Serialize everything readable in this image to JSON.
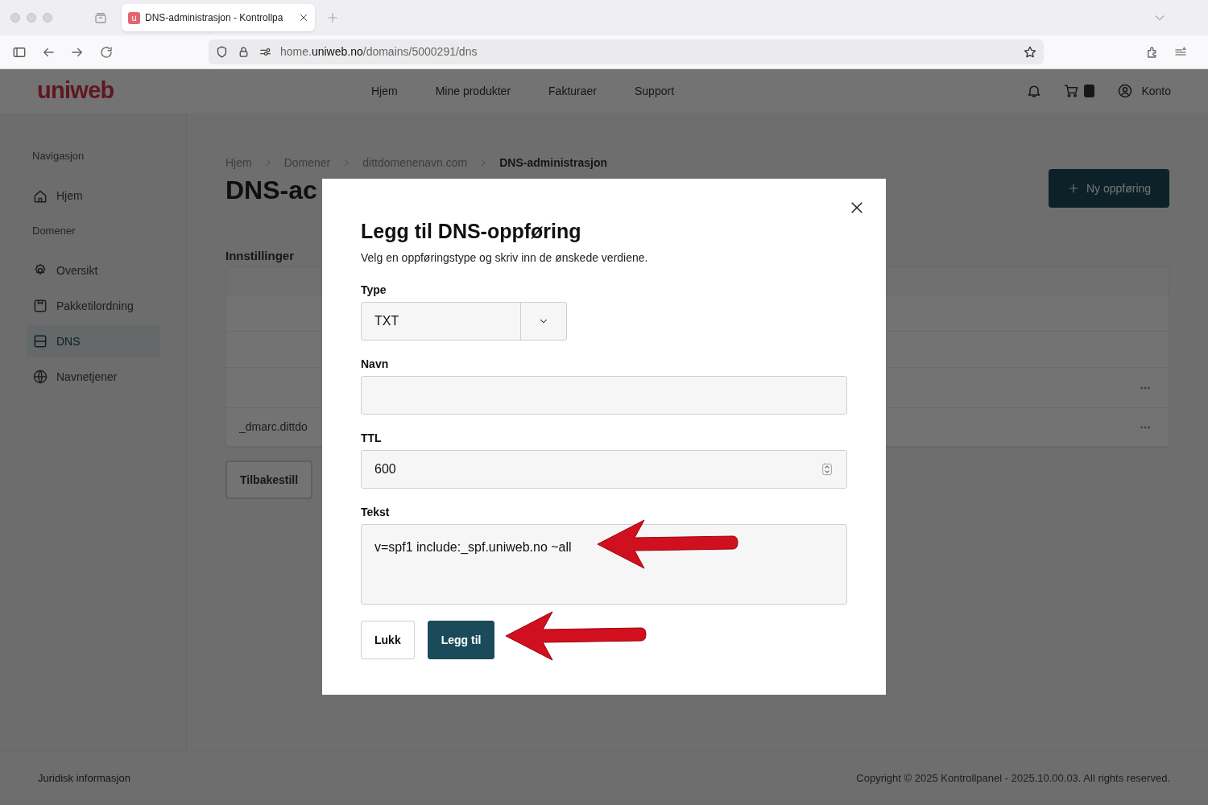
{
  "browser": {
    "tab_title": "DNS-administrasjon - Kontrollpa",
    "tab_favicon": "u",
    "url": {
      "prefix": "home.",
      "domain": "uniweb.no",
      "path": "/domains/5000291/dns"
    }
  },
  "header": {
    "logo": "uniweb",
    "nav": [
      "Hjem",
      "Mine produkter",
      "Fakturaer",
      "Support"
    ],
    "account": "Konto"
  },
  "sidebar": {
    "sections": [
      {
        "heading": "Navigasjon",
        "items": [
          {
            "label": "Hjem",
            "kind": "home",
            "selected": false
          }
        ]
      },
      {
        "heading": "Domener",
        "items": [
          {
            "label": "Oversikt",
            "kind": "gear",
            "selected": false
          },
          {
            "label": "Pakketilordning",
            "kind": "package",
            "selected": false
          },
          {
            "label": "DNS",
            "kind": "server",
            "selected": true
          },
          {
            "label": "Navnetjener",
            "kind": "globe",
            "selected": false
          }
        ]
      }
    ]
  },
  "breadcrumbs": [
    "Hjem",
    "Domener",
    "dittdomenenavn.com",
    "DNS-administrasjon"
  ],
  "page_title": "DNS-ac",
  "new_button": "Ny oppføring",
  "settings": {
    "heading": "Innstillinger",
    "rows": [
      {
        "menu": false
      },
      {
        "menu": false
      },
      {
        "menu": false
      },
      {
        "menu": true
      },
      {
        "name": "_dmarc.dittdo",
        "menu": true
      }
    ],
    "reset_button": "Tilbakestill"
  },
  "footer": {
    "left": "Juridisk informasjon",
    "right": "Copyright © 2025 Kontrollpanel - 2025.10.00.03. All rights reserved."
  },
  "dialog": {
    "title": "Legg til DNS-oppføring",
    "subtitle": "Velg en oppføringstype og skriv inn de ønskede verdiene.",
    "fields": [
      {
        "kind": "select",
        "label": "Type",
        "value": "TXT"
      },
      {
        "kind": "text",
        "label": "Navn"
      },
      {
        "kind": "number",
        "label": "TTL",
        "value": "600"
      },
      {
        "kind": "textarea",
        "label": "Tekst",
        "value": "v=spf1 include:_spf.uniweb.no ~all"
      }
    ],
    "buttons": [
      {
        "label": "Lukk",
        "primary": false
      },
      {
        "label": "Legg til",
        "primary": true
      }
    ]
  }
}
